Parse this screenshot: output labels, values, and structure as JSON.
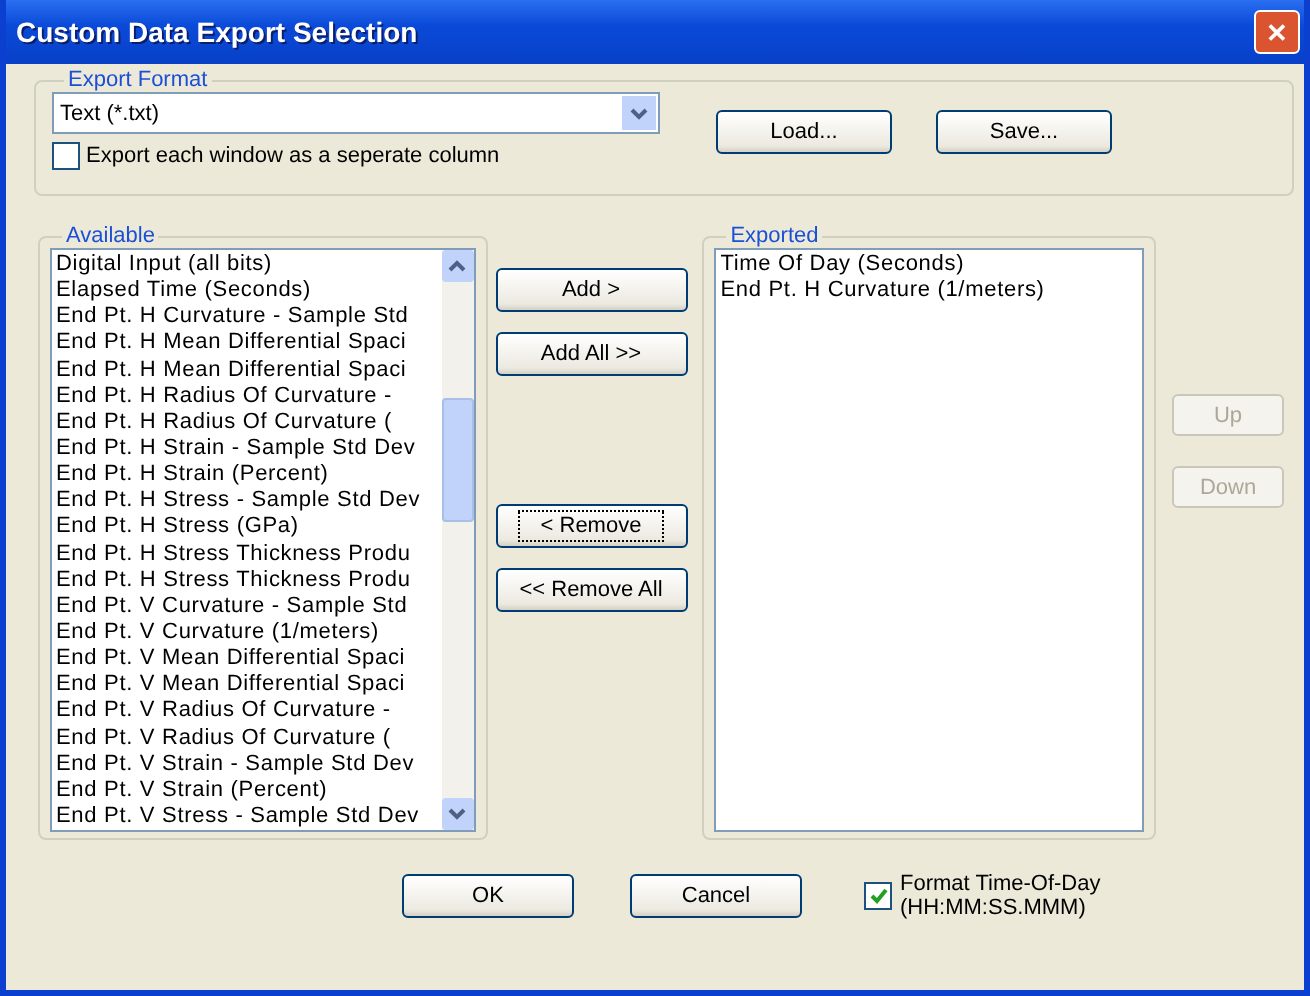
{
  "window": {
    "title": "Custom Data Export Selection",
    "close_glyph": "✕"
  },
  "export_format": {
    "legend": "Export Format",
    "dropdown_value": "Text (*.txt)",
    "checkbox": {
      "label": "Export each window as a seperate column",
      "checked": false
    },
    "buttons": [
      {
        "label": "Load..."
      },
      {
        "label": "Save..."
      }
    ]
  },
  "available": {
    "legend": "Available",
    "items": [
      {
        "label": "Digital Input (all bits)",
        "selected": false
      },
      {
        "label": "Elapsed Time (Seconds)",
        "selected": false
      },
      {
        "label": "End Pt. H Curvature - Sample Std",
        "selected": false
      },
      {
        "label": "End Pt. H Mean Differential Spaci",
        "selected": false
      },
      {
        "label": "End Pt. H Mean Differential Spaci",
        "selected": false
      },
      {
        "label": "End Pt. H Radius Of Curvature -",
        "selected": false
      },
      {
        "label": "End Pt. H Radius Of Curvature (",
        "selected": false
      },
      {
        "label": "End Pt. H Strain - Sample Std Dev",
        "selected": false
      },
      {
        "label": "End Pt. H Strain (Percent)",
        "selected": false
      },
      {
        "label": "End Pt. H Stress - Sample Std Dev",
        "selected": false
      },
      {
        "label": "End Pt. H Stress (GPa)",
        "selected": false
      },
      {
        "label": "End Pt. H Stress Thickness Produ",
        "selected": false
      },
      {
        "label": "End Pt. H Stress Thickness Produ",
        "selected": false
      },
      {
        "label": "End Pt. V Curvature - Sample Std",
        "selected": false
      },
      {
        "label": "End Pt. V Curvature (1/meters)",
        "selected": false
      },
      {
        "label": "End Pt. V Mean Differential Spaci",
        "selected": false
      },
      {
        "label": "End Pt. V Mean Differential Spaci",
        "selected": false
      },
      {
        "label": "End Pt. V Radius Of Curvature -",
        "selected": false
      },
      {
        "label": "End Pt. V Radius Of Curvature (",
        "selected": false
      },
      {
        "label": "End Pt. V Strain - Sample Std Dev",
        "selected": false
      },
      {
        "label": "End Pt. V Strain (Percent)",
        "selected": false
      },
      {
        "label": "End Pt. V Stress - Sample Std Dev",
        "selected": false
      }
    ]
  },
  "transfer_buttons": [
    {
      "label": "Add >",
      "focused": false
    },
    {
      "label": "Add All >>",
      "focused": false
    },
    {
      "label": "< Remove",
      "focused": true
    },
    {
      "label": "<< Remove All",
      "focused": false
    }
  ],
  "exported": {
    "legend": "Exported",
    "items": [
      {
        "label": "Time Of Day (Seconds)",
        "selected": false
      },
      {
        "label": "End Pt. H Curvature (1/meters)",
        "selected": false
      }
    ]
  },
  "order_buttons": [
    {
      "label": "Up",
      "disabled": true
    },
    {
      "label": "Down",
      "disabled": true
    }
  ],
  "dialog_buttons": [
    {
      "label": "OK"
    },
    {
      "label": "Cancel"
    }
  ],
  "time_format_checkbox": {
    "label_lines": [
      "Format Time-Of-Day",
      "(HH:MM:SS.MMM)"
    ],
    "checked": true
  }
}
